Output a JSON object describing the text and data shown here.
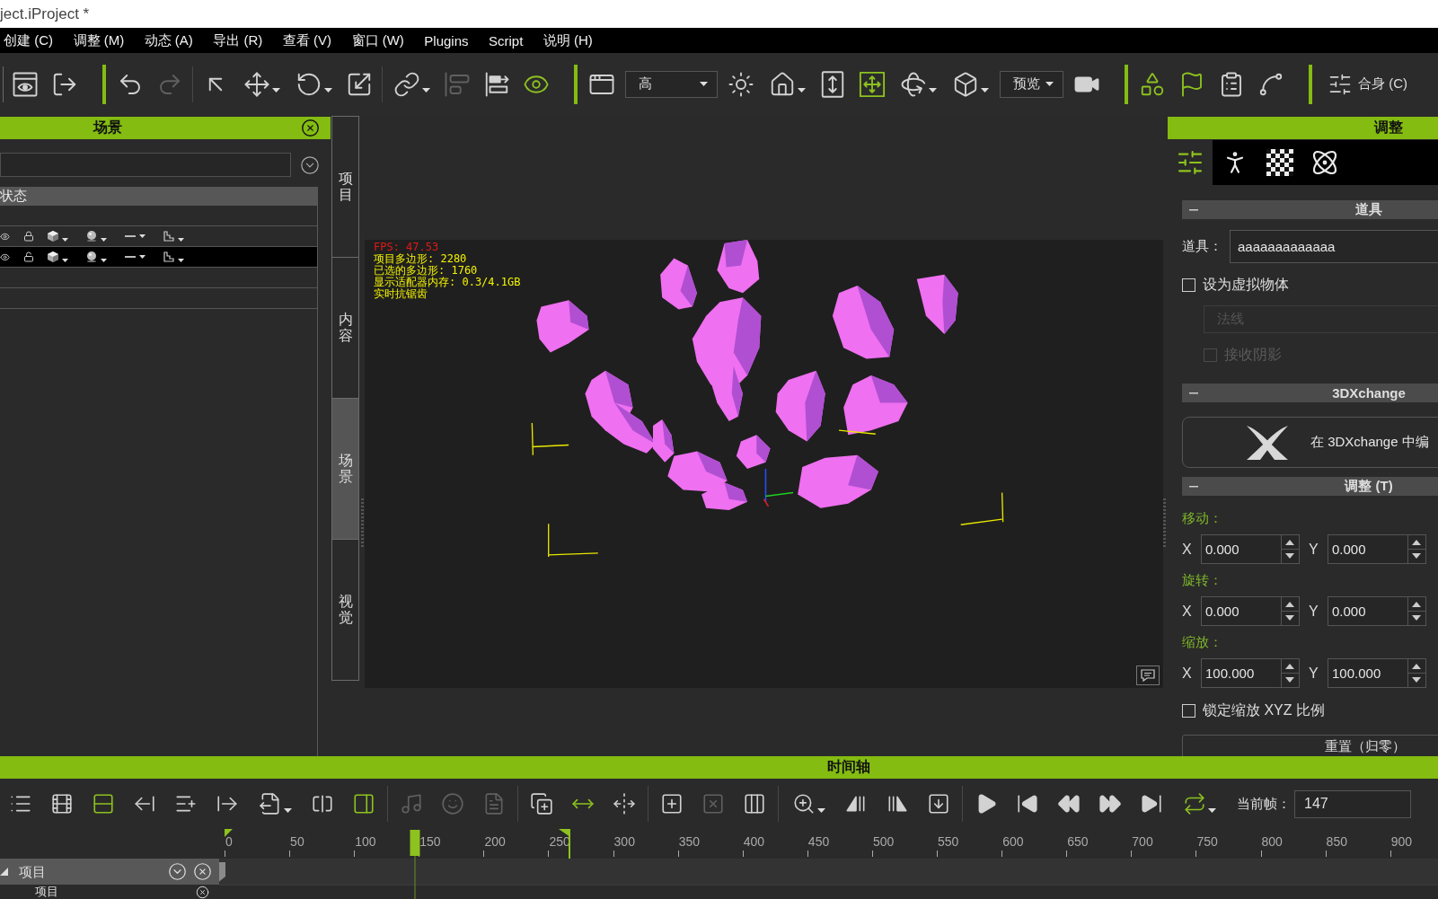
{
  "window": {
    "title": "ject.iProject *"
  },
  "menu": [
    "创建 (C)",
    "调整 (M)",
    "动态 (A)",
    "导出 (R)",
    "查看 (V)",
    "窗口 (W)",
    "Plugins",
    "Script",
    "说明 (H)"
  ],
  "toolbars": [
    {
      "groups": [
        {
          "items": [
            {
              "kind": "icon",
              "on": false,
              "disabled": false
            },
            {
              "kind": "icon",
              "on": false,
              "disabled": false
            }
          ]
        }
      ]
    },
    {
      "groups": [
        {
          "items": [
            {
              "kind": "icon",
              "on": false,
              "disabled": false
            },
            {
              "kind": "icon",
              "on": false,
              "disabled": true
            }
          ]
        },
        {
          "items": [
            {
              "kind": "icon",
              "on": false,
              "disabled": false
            },
            {
              "kind": "icon",
              "on": false,
              "disabled": false
            },
            {
              "kind": "icon",
              "on": false,
              "disabled": false
            },
            {
              "kind": "icon",
              "on": false,
              "disabled": false
            }
          ]
        },
        {
          "items": [
            {
              "kind": "icon",
              "on": false,
              "disabled": false
            },
            {
              "kind": "icon",
              "on": false,
              "disabled": true
            },
            {
              "kind": "icon",
              "on": false,
              "disabled": false
            },
            {
              "kind": "icon",
              "on": true,
              "disabled": false
            }
          ]
        }
      ]
    },
    {
      "groups": [
        {
          "items": [
            {
              "kind": "icon",
              "on": false,
              "disabled": false
            },
            {
              "kind": "select",
              "value": "高"
            },
            {
              "kind": "icon",
              "on": false,
              "disabled": false
            },
            {
              "kind": "icon",
              "on": false,
              "disabled": false
            },
            {
              "kind": "icon",
              "on": false,
              "disabled": false
            },
            {
              "kind": "icon",
              "on": true,
              "disabled": false
            },
            {
              "kind": "icon",
              "on": false,
              "disabled": false
            },
            {
              "kind": "icon",
              "on": false,
              "disabled": false
            },
            {
              "kind": "select",
              "value": "预览"
            },
            {
              "kind": "icon",
              "on": false,
              "disabled": false
            }
          ]
        }
      ]
    },
    {
      "groups": [
        {
          "items": [
            {
              "kind": "icon",
              "on": true,
              "disabled": false
            },
            {
              "kind": "icon",
              "on": true,
              "disabled": false
            },
            {
              "kind": "icon",
              "on": false,
              "disabled": false
            },
            {
              "kind": "icon",
              "on": false,
              "disabled": false
            }
          ]
        }
      ]
    },
    {
      "groups": [
        {
          "items": [
            {
              "kind": "button",
              "label": "合身 (C)"
            }
          ]
        }
      ]
    }
  ],
  "scene_panel": {
    "title": "场景",
    "column": "状态",
    "rows": [
      {
        "kind": "blank",
        "selected": false
      },
      {
        "kind": "object",
        "selected": false,
        "locked": true
      },
      {
        "kind": "object",
        "selected": true,
        "locked": false
      },
      {
        "kind": "blank",
        "selected": false
      },
      {
        "kind": "blank",
        "selected": false
      }
    ]
  },
  "side_tabs": [
    {
      "label": "项目",
      "selected": false
    },
    {
      "label": "内容",
      "selected": false
    },
    {
      "label": "场景",
      "selected": true
    },
    {
      "label": "视觉",
      "selected": false
    }
  ],
  "viewport": {
    "fps": "FPS: 47.53",
    "stats": [
      "项目多边形: 2280",
      "已选的多边形: 1760",
      "显示适配器内存: 0.3/4.1GB",
      "实时抗锯齿"
    ]
  },
  "modify_panel": {
    "title": "调整",
    "tabs": [
      {
        "selected": true
      },
      {
        "selected": false
      },
      {
        "selected": false
      },
      {
        "selected": false
      }
    ],
    "sections": [
      {
        "title": "道具",
        "expanded": true,
        "items": [
          {
            "kind": "text-field",
            "label": "道具：",
            "value": "aaaaaaaaaaaaa"
          },
          {
            "kind": "checkbox",
            "label": "设为虚拟物体",
            "checked": false,
            "disabled": false,
            "children": [
              {
                "kind": "select",
                "value": "法线",
                "disabled": true
              },
              {
                "kind": "checkbox",
                "label": "接收阴影",
                "checked": false,
                "disabled": true
              }
            ]
          }
        ]
      },
      {
        "title": "3DXchange",
        "expanded": true,
        "items": [
          {
            "kind": "logo-button",
            "label": "在 3DXchange 中编"
          }
        ]
      },
      {
        "title": "调整 (T)",
        "expanded": true,
        "items": [
          {
            "kind": "vector",
            "label": "移动：",
            "fields": [
              {
                "axis": "X",
                "value": "0.000"
              },
              {
                "axis": "Y",
                "value": "0.000"
              }
            ]
          },
          {
            "kind": "vector",
            "label": "旋转：",
            "fields": [
              {
                "axis": "X",
                "value": "0.000"
              },
              {
                "axis": "Y",
                "value": "0.000"
              }
            ]
          },
          {
            "kind": "vector",
            "label": "缩放：",
            "fields": [
              {
                "axis": "X",
                "value": "100.000"
              },
              {
                "axis": "Y",
                "value": "100.000"
              }
            ]
          },
          {
            "kind": "checkbox",
            "label": "锁定缩放 XYZ 比例",
            "checked": false,
            "disabled": false
          },
          {
            "kind": "button",
            "label": "重置（归零）"
          }
        ]
      }
    ]
  },
  "timeline": {
    "title": "时间轴",
    "toolbar": {
      "groups": [
        {
          "items": [
            {
              "on": false,
              "disabled": false
            },
            {
              "on": false,
              "disabled": false
            },
            {
              "on": true,
              "disabled": false
            },
            {
              "on": false,
              "disabled": false
            },
            {
              "on": false,
              "disabled": false
            },
            {
              "on": false,
              "disabled": false
            },
            {
              "on": false,
              "disabled": false
            },
            {
              "on": false,
              "disabled": false
            },
            {
              "on": true,
              "disabled": false
            }
          ]
        },
        {
          "items": [
            {
              "on": false,
              "disabled": true
            },
            {
              "on": false,
              "disabled": true
            },
            {
              "on": false,
              "disabled": true
            }
          ]
        },
        {
          "items": [
            {
              "on": false,
              "disabled": false
            },
            {
              "on": true,
              "disabled": false
            },
            {
              "on": false,
              "disabled": false
            }
          ]
        },
        {
          "items": [
            {
              "on": false,
              "disabled": false
            },
            {
              "on": false,
              "disabled": true
            },
            {
              "on": false,
              "disabled": false
            }
          ]
        },
        {
          "items": [
            {
              "on": false,
              "disabled": false
            },
            {
              "on": false,
              "disabled": false
            },
            {
              "on": false,
              "disabled": false
            },
            {
              "on": false,
              "disabled": false
            }
          ]
        },
        {
          "items": [
            {
              "on": false,
              "disabled": false
            },
            {
              "on": false,
              "disabled": false
            },
            {
              "on": false,
              "disabled": false
            },
            {
              "on": false,
              "disabled": false
            },
            {
              "on": false,
              "disabled": false
            },
            {
              "on": true,
              "disabled": false
            }
          ]
        }
      ]
    },
    "current_frame": {
      "label": "当前帧：",
      "value": "147"
    },
    "ruler": {
      "labels": [
        "0",
        "50",
        "100",
        "150",
        "200",
        "250",
        "300",
        "350",
        "400",
        "450",
        "500",
        "550",
        "600",
        "650",
        "700",
        "750",
        "800",
        "850",
        "900"
      ]
    },
    "range_start": {
      "level": 0
    },
    "range_end": {
      "level": 0.281
    },
    "playhead": {
      "level": 0.155
    },
    "tracks": [
      {
        "label": "项目",
        "expanded": true,
        "children": [
          {
            "label": "项目"
          }
        ]
      }
    ]
  }
}
